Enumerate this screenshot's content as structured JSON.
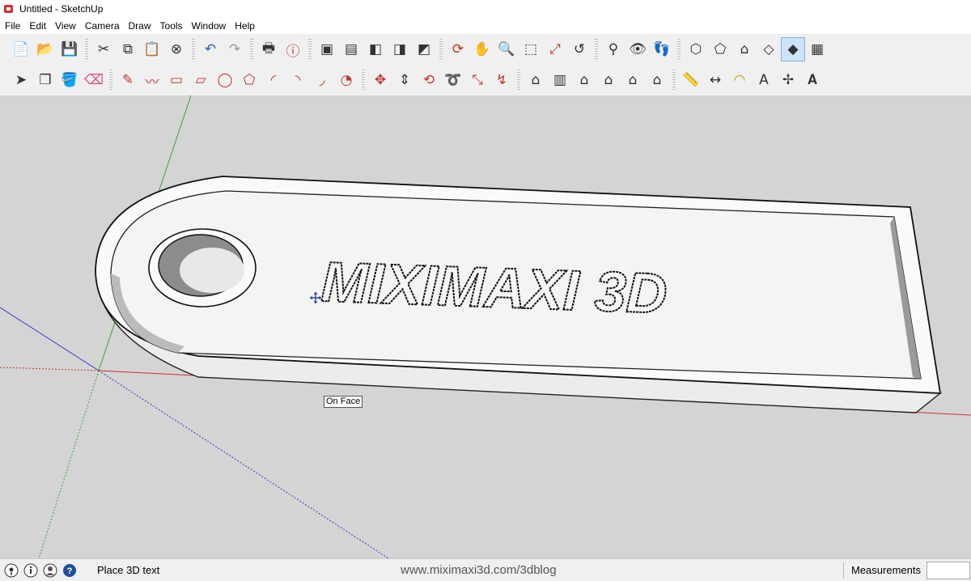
{
  "window": {
    "title": "Untitled - SketchUp"
  },
  "menu": [
    "File",
    "Edit",
    "View",
    "Camera",
    "Draw",
    "Tools",
    "Window",
    "Help"
  ],
  "toolbar_row1": [
    "new-icon",
    "open-icon",
    "save-icon",
    "cut-icon",
    "copy-icon",
    "paste-icon",
    "erase-icon",
    "undo-icon",
    "redo-icon",
    "print-icon",
    "model-info-icon",
    "component-icon",
    "group-icon",
    "solid-icon",
    "solid2-icon",
    "solid3-icon",
    "orbit-icon",
    "pan-icon",
    "zoom-icon",
    "zoom-window-icon",
    "zoom-extents-icon",
    "previous-icon",
    "position-camera-icon",
    "look-around-icon",
    "walk-icon",
    "iso-view-icon",
    "top-view-icon",
    "front-view-icon",
    "right-view-icon",
    "back-view-icon",
    "left-view-icon"
  ],
  "toolbar_row2": [
    "select-icon",
    "make-component-icon",
    "paint-bucket-icon",
    "eraser-icon",
    "line-icon",
    "freehand-icon",
    "rectangle-icon",
    "rotated-rectangle-icon",
    "circle-icon",
    "polygon-icon",
    "arc-icon",
    "arc2-icon",
    "arc3-icon",
    "pie-icon",
    "move-icon",
    "push-pull-icon",
    "rotate-icon",
    "follow-me-icon",
    "scale-icon",
    "offset-icon",
    "warehouse-icon",
    "components-panel-icon",
    "home-icon",
    "house2-icon",
    "house3-icon",
    "house4-icon",
    "tape-measure-icon",
    "dimension-icon",
    "protractor-icon",
    "text-icon",
    "axes-icon",
    "3d-text-icon"
  ],
  "viewport": {
    "model_text": "MIXIMAXI 3D",
    "tooltip": "On Face"
  },
  "status": {
    "message": "Place 3D text",
    "watermark": "www.miximaxi3d.com/3dblog",
    "measurements_label": "Measurements",
    "measurements_value": ""
  },
  "colors": {
    "viewport_bg": "#d4d4d4",
    "red_axis": "#d03030",
    "green_axis": "#3aa33a",
    "blue_axis": "#2f3fbf"
  }
}
